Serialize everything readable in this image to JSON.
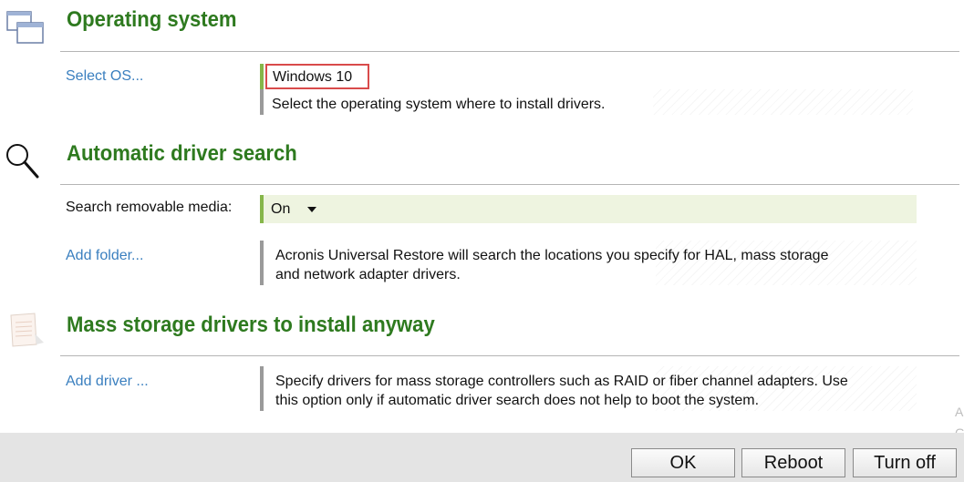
{
  "sections": {
    "os": {
      "title": "Operating system",
      "select_link": "Select OS...",
      "selected_os": "Windows 10",
      "description": "Select the operating system where to install drivers."
    },
    "auto_search": {
      "title": "Automatic driver search",
      "removable_label": "Search removable media:",
      "removable_value": "On",
      "add_folder_link": "Add folder...",
      "description_line1": "Acronis Universal Restore will search the locations you specify for HAL, mass storage",
      "description_line2": "and network adapter drivers."
    },
    "mass_storage": {
      "title": "Mass storage drivers to install anyway",
      "add_driver_link": "Add driver ...",
      "description_line1": "Specify drivers for mass storage controllers such as RAID or fiber channel adapters. Use",
      "description_line2": "this option only if automatic driver search does not help to boot the system."
    }
  },
  "footer": {
    "ok_label": "OK",
    "reboot_label": "Reboot",
    "turnoff_label": "Turn off"
  },
  "edge_glyphs": [
    "A",
    "G"
  ],
  "icons": [
    "windows-icon",
    "magnifier-icon",
    "document-icon"
  ],
  "colors": {
    "title_green": "#2e7a1f",
    "link_blue": "#3a7fbf",
    "highlight_red": "#d94b4b",
    "toggle_bg": "#eef4e0"
  }
}
